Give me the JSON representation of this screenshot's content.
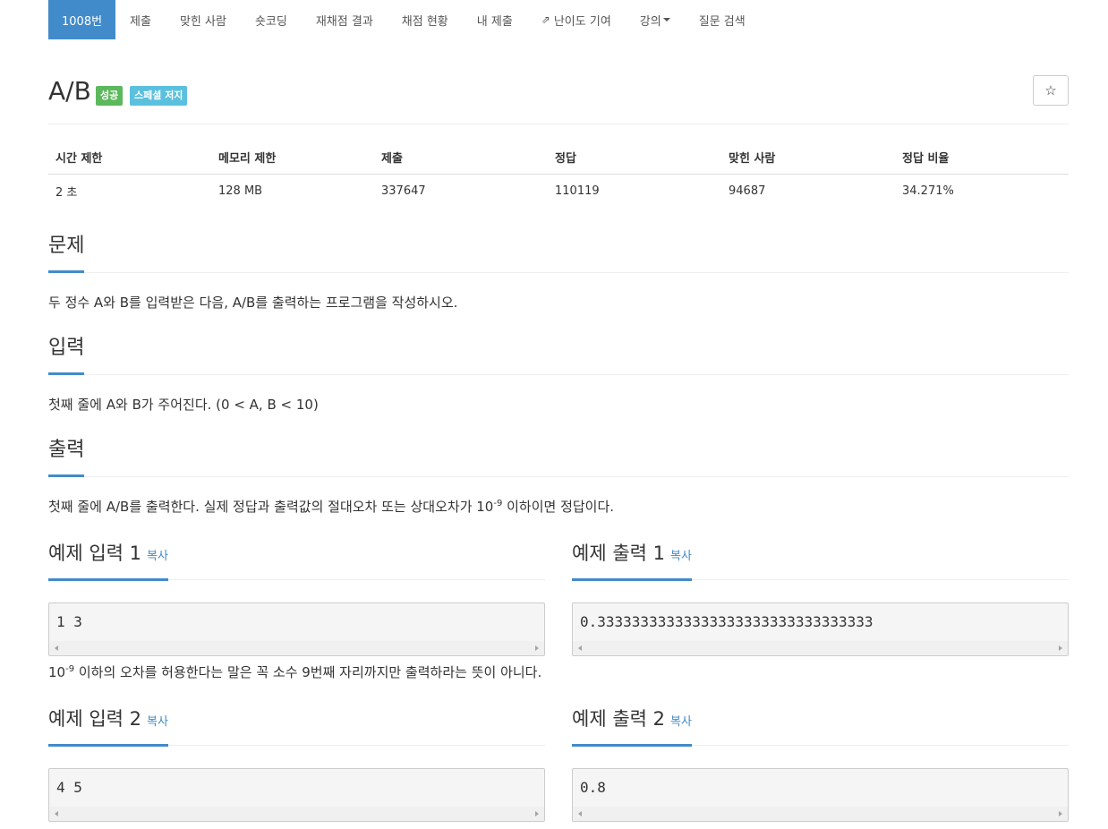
{
  "nav": {
    "items": [
      {
        "label": "1008번",
        "active": true
      },
      {
        "label": "제출"
      },
      {
        "label": "맞힌 사람"
      },
      {
        "label": "숏코딩"
      },
      {
        "label": "재채점 결과"
      },
      {
        "label": "채점 현황"
      },
      {
        "label": "내 제출"
      },
      {
        "label": "난이도 기여",
        "icon": "external-link-icon"
      },
      {
        "label": "강의",
        "dropdown": true
      },
      {
        "label": "질문 검색"
      }
    ]
  },
  "problem": {
    "title": "A/B",
    "labels": {
      "success": "성공",
      "special": "스페셜 저지"
    },
    "star_icon": "☆"
  },
  "info": {
    "headers": [
      "시간 제한",
      "메모리 제한",
      "제출",
      "정답",
      "맞힌 사람",
      "정답 비율"
    ],
    "values": [
      "2 초",
      "128 MB",
      "337647",
      "110119",
      "94687",
      "34.271%"
    ]
  },
  "sections": {
    "problem_head": "문제",
    "problem_text": "두 정수 A와 B를 입력받은 다음, A/B를 출력하는 프로그램을 작성하시오.",
    "input_head": "입력",
    "input_text": "첫째 줄에 A와 B가 주어진다. (0 < A, B < 10)",
    "output_head": "출력",
    "output_text_pre": "첫째 줄에 A/B를 출력한다. 실제 정답과 출력값의 절대오차 또는 상대오차가 10",
    "output_text_sup": "-9",
    "output_text_post": " 이하이면 정답이다."
  },
  "samples": {
    "copy_label": "복사",
    "input1_head": "예제 입력 1",
    "input1": "1 3",
    "output1_head": "예제 출력 1",
    "output1": "0.33333333333333333333333333333333",
    "note_pre": "10",
    "note_sup": "-9",
    "note_post": " 이하의 오차를 허용한다는 말은 꼭 소수 9번째 자리까지만 출력하라는 뜻이 아니다.",
    "input2_head": "예제 입력 2",
    "input2": "4 5",
    "output2_head": "예제 출력 2",
    "output2": "0.8"
  },
  "colors": {
    "accent": "#428bca",
    "success": "#5cb85c",
    "info": "#5bc0de"
  }
}
